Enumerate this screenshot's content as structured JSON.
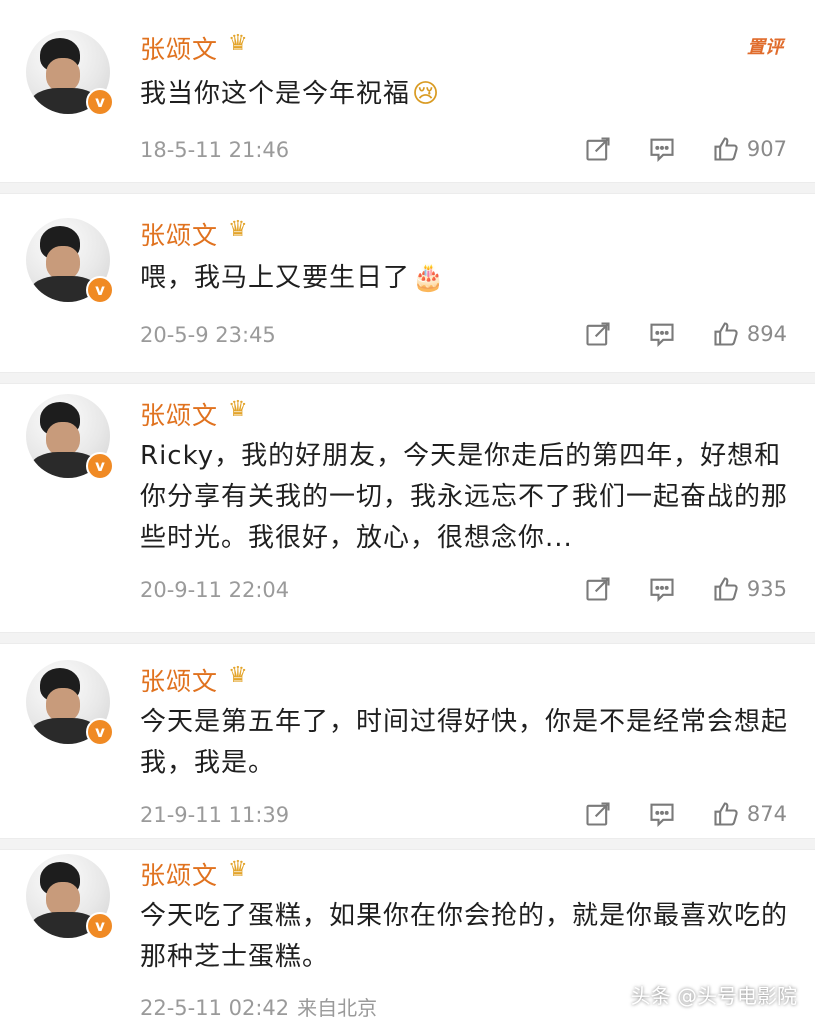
{
  "posts": [
    {
      "name": "张颂文",
      "content": "我当你这个是今年祝福",
      "emoji": "😢",
      "time": "18-5-11 21:46",
      "likes": "907",
      "hot_label": "置评"
    },
    {
      "name": "张颂文",
      "content": "喂，我马上又要生日了",
      "emoji": "🎂",
      "time": "20-5-9 23:45",
      "likes": "894"
    },
    {
      "name": "张颂文",
      "content": "Ricky，我的好朋友，今天是你走后的第四年，好想和你分享有关我的一切，我永远忘不了我们一起奋战的那些时光。我很好，放心，很想念你...",
      "time": "20-9-11 22:04",
      "likes": "935"
    },
    {
      "name": "张颂文",
      "content": "今天是第五年了，时间过得好快，你是不是经常会想起我，我是。",
      "time": "21-9-11 11:39",
      "likes": "874"
    },
    {
      "name": "张颂文",
      "content": "今天吃了蛋糕，如果你在你会抢的，就是你最喜欢吃的那种芝士蛋糕。",
      "time": "22-5-11 02:42",
      "source": "来自北京"
    }
  ],
  "badge": "v",
  "watermark": "头条 @头号电影院",
  "icons": {
    "repost": "share-icon",
    "comment": "comment-icon",
    "like": "thumbs-up-icon",
    "crown": "crown-icon"
  },
  "colors": {
    "name": "#e0721f",
    "time": "#9a9a9a",
    "badge": "#f08a24"
  }
}
